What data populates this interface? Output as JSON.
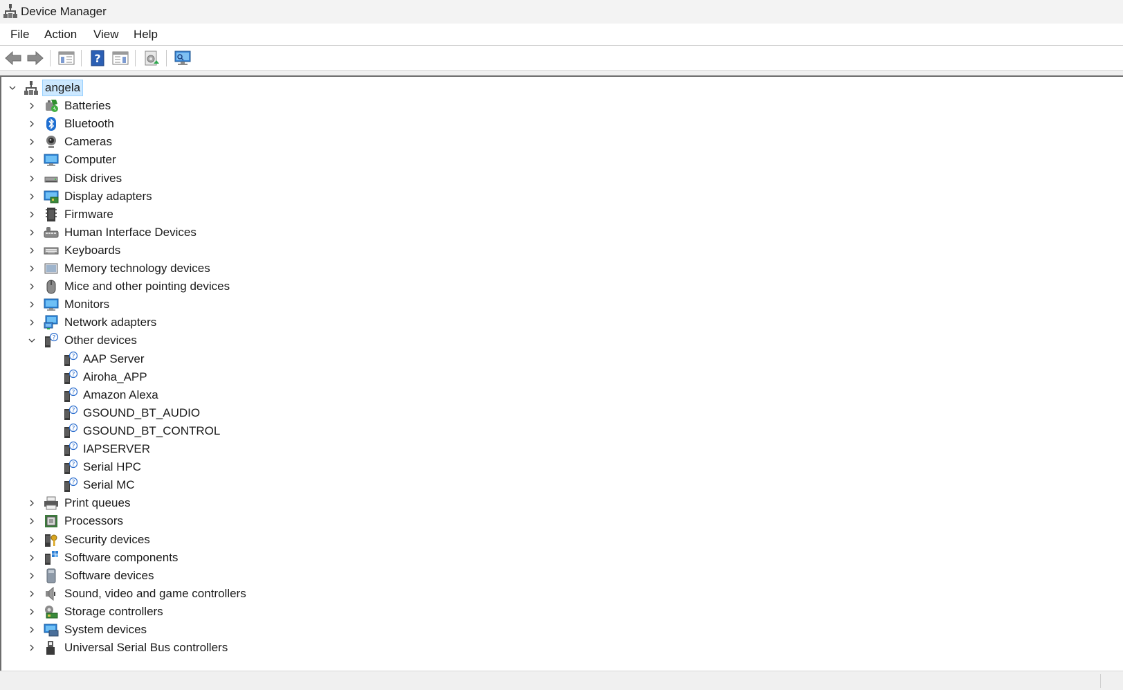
{
  "window": {
    "title": "Device Manager",
    "app_icon": "device-manager-icon"
  },
  "menu": [
    "File",
    "Action",
    "View",
    "Help"
  ],
  "toolbar": [
    {
      "name": "back-button",
      "icon": "arrow-left-icon"
    },
    {
      "name": "forward-button",
      "icon": "arrow-right-icon"
    },
    {
      "name": "show-hide-console-tree-button",
      "icon": "console-tree-icon"
    },
    {
      "name": "help-button",
      "icon": "help-icon"
    },
    {
      "name": "show-hide-action-pane-button",
      "icon": "action-pane-icon"
    },
    {
      "name": "update-driver-button",
      "icon": "update-driver-icon"
    },
    {
      "name": "scan-hardware-button",
      "icon": "scan-hardware-icon"
    }
  ],
  "tree": {
    "root": {
      "label": "angela",
      "icon": "computer-network-icon",
      "expanded": true,
      "selected": true
    },
    "categories": [
      {
        "label": "Batteries",
        "icon": "battery-icon"
      },
      {
        "label": "Bluetooth",
        "icon": "bluetooth-icon"
      },
      {
        "label": "Cameras",
        "icon": "camera-icon"
      },
      {
        "label": "Computer",
        "icon": "monitor-icon"
      },
      {
        "label": "Disk drives",
        "icon": "disk-drive-icon"
      },
      {
        "label": "Display adapters",
        "icon": "display-adapter-icon"
      },
      {
        "label": "Firmware",
        "icon": "firmware-icon"
      },
      {
        "label": "Human Interface Devices",
        "icon": "hid-icon"
      },
      {
        "label": "Keyboards",
        "icon": "keyboard-icon"
      },
      {
        "label": "Memory technology devices",
        "icon": "memory-device-icon"
      },
      {
        "label": "Mice and other pointing devices",
        "icon": "mouse-icon"
      },
      {
        "label": "Monitors",
        "icon": "monitor-icon"
      },
      {
        "label": "Network adapters",
        "icon": "network-adapter-icon"
      },
      {
        "label": "Other devices",
        "icon": "unknown-device-icon",
        "expanded": true,
        "children": [
          {
            "label": "AAP Server",
            "icon": "unknown-device-icon"
          },
          {
            "label": "Airoha_APP",
            "icon": "unknown-device-icon"
          },
          {
            "label": "Amazon Alexa",
            "icon": "unknown-device-icon"
          },
          {
            "label": "GSOUND_BT_AUDIO",
            "icon": "unknown-device-icon"
          },
          {
            "label": "GSOUND_BT_CONTROL",
            "icon": "unknown-device-icon"
          },
          {
            "label": "IAPSERVER",
            "icon": "unknown-device-icon"
          },
          {
            "label": "Serial HPC",
            "icon": "unknown-device-icon"
          },
          {
            "label": "Serial MC",
            "icon": "unknown-device-icon"
          }
        ]
      },
      {
        "label": "Print queues",
        "icon": "printer-icon"
      },
      {
        "label": "Processors",
        "icon": "processor-icon"
      },
      {
        "label": "Security devices",
        "icon": "security-device-icon"
      },
      {
        "label": "Software components",
        "icon": "software-component-icon"
      },
      {
        "label": "Software devices",
        "icon": "software-device-icon"
      },
      {
        "label": "Sound, video and game controllers",
        "icon": "speaker-icon"
      },
      {
        "label": "Storage controllers",
        "icon": "storage-controller-icon"
      },
      {
        "label": "System devices",
        "icon": "system-device-icon"
      },
      {
        "label": "Universal Serial Bus controllers",
        "icon": "usb-icon"
      }
    ]
  }
}
